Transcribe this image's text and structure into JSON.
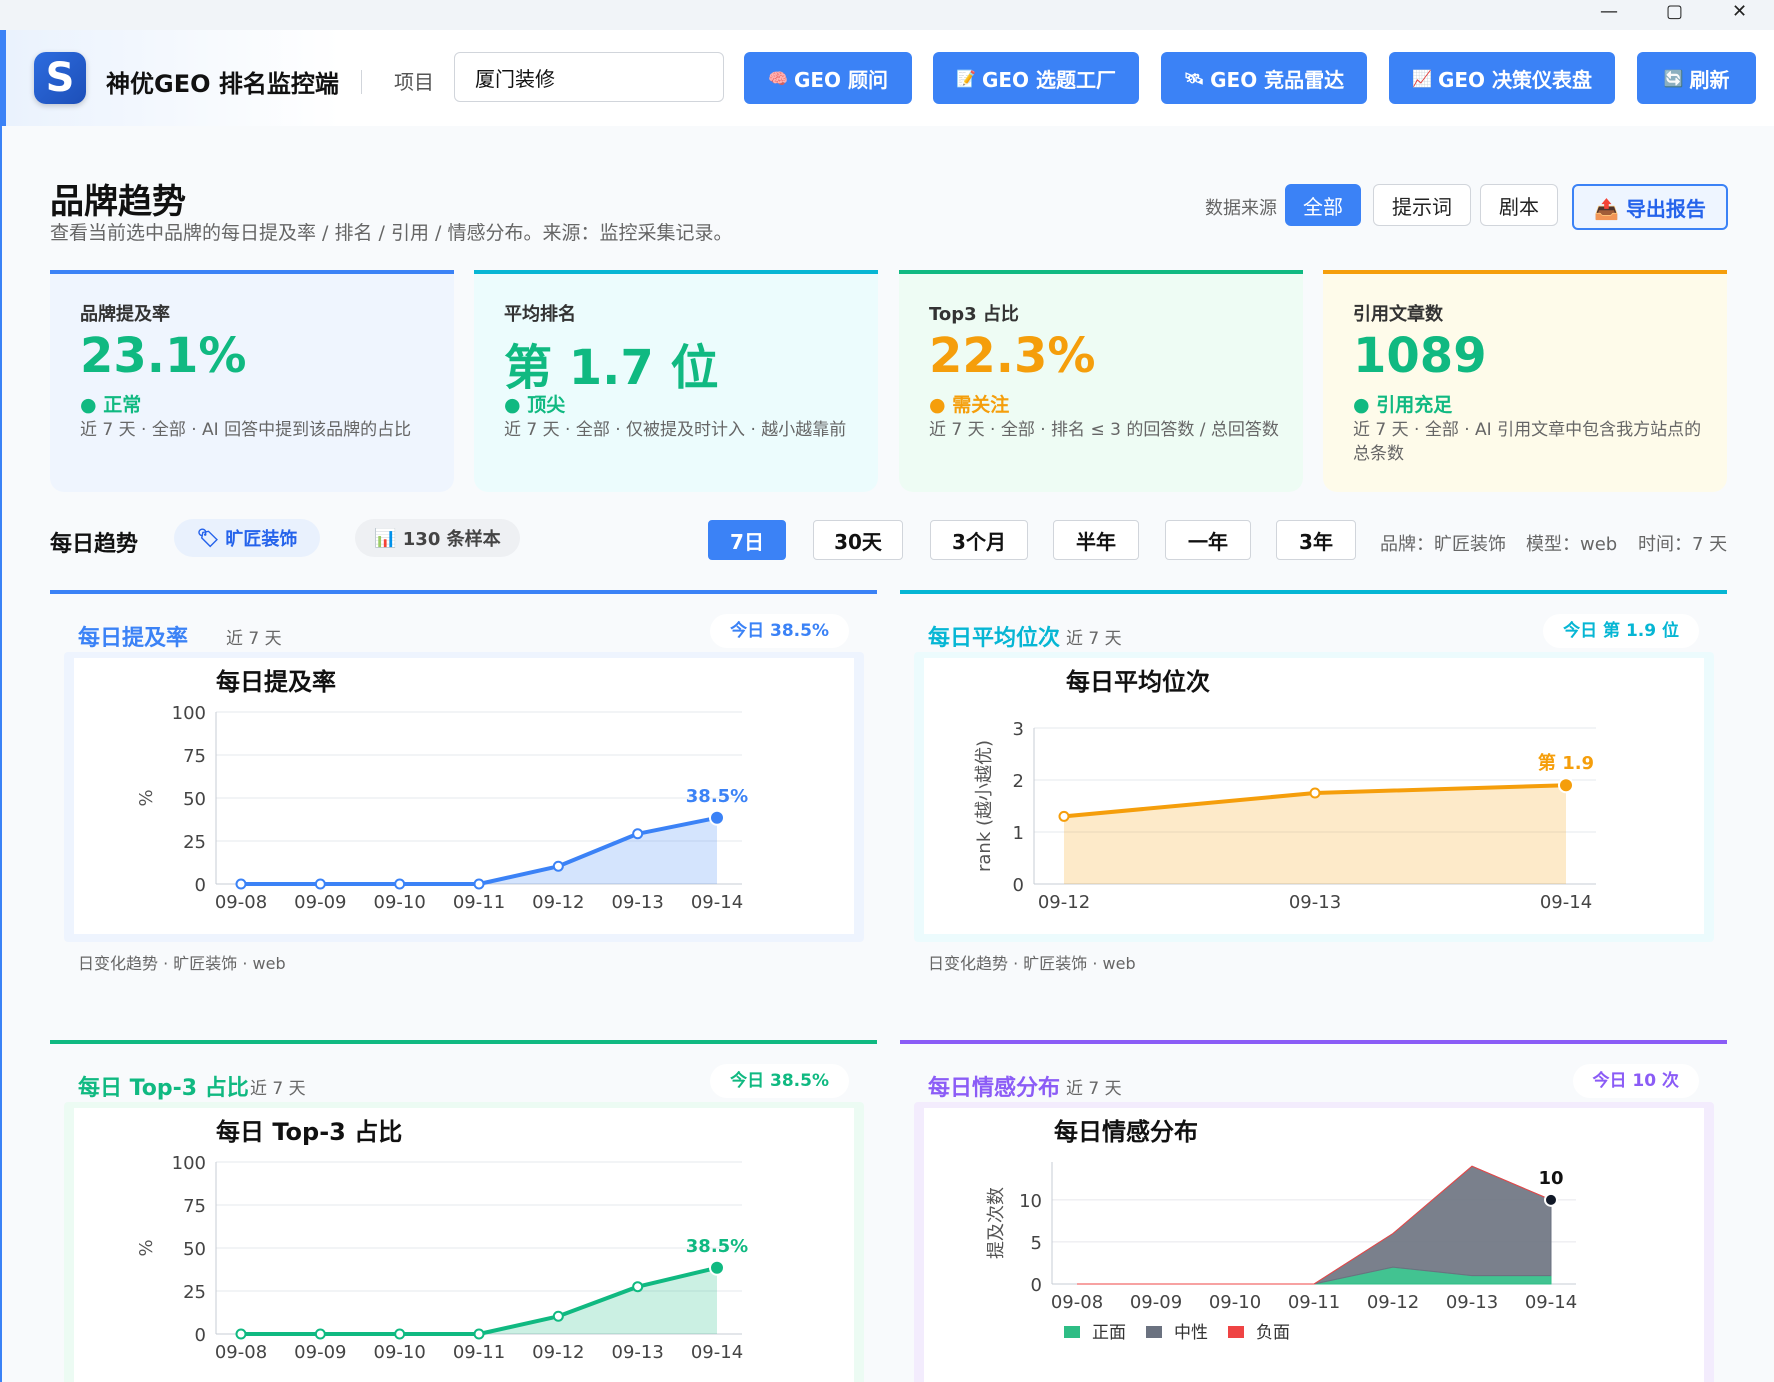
{
  "window": {
    "minimize": "—",
    "maximize": "▢",
    "close": "✕"
  },
  "app": {
    "logo_letter": "S",
    "name": "神优GEO 排名监控端"
  },
  "header": {
    "project_label": "项目",
    "project_value": "厦门装修",
    "buttons": [
      {
        "icon": "🧠",
        "label": "GEO 顾问"
      },
      {
        "icon": "📝",
        "label": "GEO 选题工厂"
      },
      {
        "icon": "🛰",
        "label": "GEO 竞品雷达"
      },
      {
        "icon": "📈",
        "label": "GEO 决策仪表盘"
      },
      {
        "icon": "🔄",
        "label": "刷新"
      }
    ]
  },
  "page": {
    "title": "品牌趋势",
    "subtitle": "查看当前选中品牌的每日提及率 / 排名 / 引用 / 情感分布。来源：监控采集记录。",
    "datasource_label": "数据来源",
    "datasource_options": [
      "全部",
      "提示词",
      "剧本"
    ],
    "datasource_active": "全部",
    "export_icon": "📤",
    "export_label": "导出报告"
  },
  "kpis": [
    {
      "label": "品牌提及率",
      "value": "23.1%",
      "status": "正常",
      "desc": "近 7 天 · 全部 · AI 回答中提到该品牌的占比",
      "color": "#10b981",
      "border": "#3b82f6",
      "bg": "#eff5fe"
    },
    {
      "label": "平均排名",
      "value": "第 1.7 位",
      "status": "顶尖",
      "desc": "近 7 天 · 全部 · 仅被提及时计入 · 越小越靠前",
      "color": "#10b981",
      "border": "#06b6d4",
      "bg": "#ecfcfd"
    },
    {
      "label": "Top3 占比",
      "value": "22.3%",
      "status": "需关注",
      "desc": "近 7 天 · 全部 · 排名 ≤ 3 的回答数 / 总回答数",
      "color": "#f59e0b",
      "border": "#10b981",
      "bg": "#eefcf4"
    },
    {
      "label": "引用文章数",
      "value": "1089",
      "status": "引用充足",
      "desc": "近 7 天 · 全部 · AI 引用文章中包含我方站点的总条数",
      "color": "#10b981",
      "border": "#f59e0b",
      "bg": "#fefbea"
    }
  ],
  "trend": {
    "header": "每日趋势",
    "brand_chip": "旷匠装饰",
    "brand_icon": "🏷",
    "sample_chip": "130 条样本",
    "sample_icon": "📊",
    "ranges": [
      "7日",
      "30天",
      "3个月",
      "半年",
      "一年",
      "3年"
    ],
    "range_active": "7日",
    "meta_brand": "品牌：旷匠装饰",
    "meta_model": "模型：web",
    "meta_time": "时间：7 天"
  },
  "cards": [
    {
      "title": "每日提及率",
      "sub": "近 7 天",
      "badge": "今日 38.5%",
      "foot": "日变化趋势 · 旷匠装饰 · web"
    },
    {
      "title": "每日平均位次",
      "sub": "近 7 天",
      "badge": "今日 第 1.9 位",
      "foot": "日变化趋势 · 旷匠装饰 · web"
    },
    {
      "title": "每日 Top-3 占比",
      "sub": "近 7 天",
      "badge": "今日 38.5%",
      "foot": ""
    },
    {
      "title": "每日情感分布",
      "sub": "近 7 天",
      "badge": "今日 10 次",
      "foot": ""
    }
  ],
  "chart_data": [
    {
      "type": "area",
      "title": "每日提及率",
      "ylabel": "%",
      "x": [
        "09-08",
        "09-09",
        "09-10",
        "09-11",
        "09-12",
        "09-13",
        "09-14"
      ],
      "values": [
        0,
        0,
        0,
        0,
        10.3,
        29.2,
        38.5
      ],
      "ylim": [
        0,
        100
      ],
      "yticks": [
        0,
        25,
        50,
        75,
        100
      ],
      "last_label": "38.5%",
      "color": "#3b82f6"
    },
    {
      "type": "area",
      "title": "每日平均位次",
      "ylabel": "rank (越小越优)",
      "x": [
        "09-12",
        "09-13",
        "09-14"
      ],
      "values": [
        1.3,
        1.75,
        1.9
      ],
      "ylim": [
        0,
        3
      ],
      "yticks": [
        0,
        1,
        2,
        3
      ],
      "last_label": "第 1.9",
      "color": "#f59e0b"
    },
    {
      "type": "area",
      "title": "每日 Top-3 占比",
      "ylabel": "%",
      "x": [
        "09-08",
        "09-09",
        "09-10",
        "09-11",
        "09-12",
        "09-13",
        "09-14"
      ],
      "values": [
        0,
        0,
        0,
        0,
        10.3,
        27.5,
        38.5
      ],
      "ylim": [
        0,
        100
      ],
      "yticks": [
        0,
        25,
        50,
        75,
        100
      ],
      "last_label": "38.5%",
      "color": "#10b981"
    },
    {
      "type": "area",
      "title": "每日情感分布",
      "ylabel": "提及次数",
      "x": [
        "09-08",
        "09-09",
        "09-10",
        "09-11",
        "09-12",
        "09-13",
        "09-14"
      ],
      "ylim": [
        0,
        14.5
      ],
      "yticks": [
        0,
        5,
        10
      ],
      "last_label": "10",
      "series": [
        {
          "name": "正面",
          "values": [
            0,
            0,
            0,
            0,
            2,
            1,
            1
          ],
          "color": "#2ebd85"
        },
        {
          "name": "中性",
          "values": [
            0,
            0,
            0,
            0,
            4,
            13,
            9
          ],
          "color": "#6b7280"
        },
        {
          "name": "负面",
          "values": [
            0,
            0,
            0,
            0,
            0,
            0,
            0
          ],
          "color": "#ef4444"
        }
      ]
    }
  ]
}
